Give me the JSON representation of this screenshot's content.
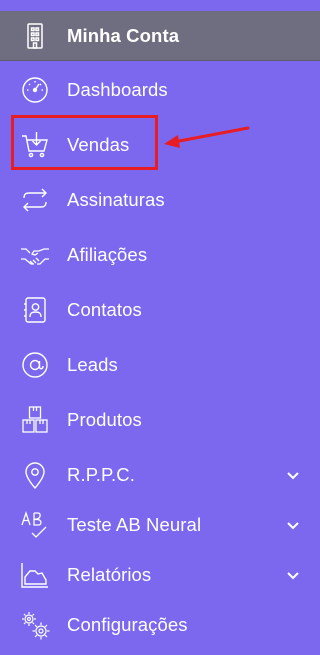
{
  "sidebar": {
    "background": "#7b68ee",
    "active_background": "#6e6e80",
    "items": [
      {
        "label": "Minha Conta",
        "icon": "building-icon",
        "active": true
      },
      {
        "label": "Dashboards",
        "icon": "gauge-icon"
      },
      {
        "label": "Vendas",
        "icon": "cart-download-icon"
      },
      {
        "label": "Assinaturas",
        "icon": "repeat-icon"
      },
      {
        "label": "Afiliações",
        "icon": "handshake-icon"
      },
      {
        "label": "Contatos",
        "icon": "contact-card-icon"
      },
      {
        "label": "Leads",
        "icon": "at-sign-icon"
      },
      {
        "label": "Produtos",
        "icon": "boxes-icon"
      },
      {
        "label": "R.P.P.C.",
        "icon": "map-pin-icon",
        "expandable": true
      },
      {
        "label": "Teste AB Neural",
        "icon": "ab-test-icon",
        "expandable": true
      },
      {
        "label": "Relatórios",
        "icon": "area-chart-icon",
        "expandable": true
      },
      {
        "label": "Configurações",
        "icon": "gears-icon"
      }
    ]
  },
  "annotation": {
    "highlight_color": "#e81c23",
    "target": "Vendas"
  }
}
